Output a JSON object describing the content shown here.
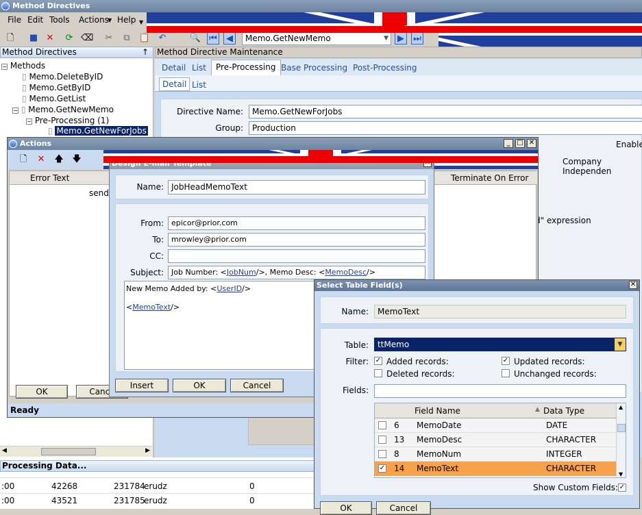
{
  "app": {
    "title": "Method Directives"
  },
  "menu": [
    "File",
    "Edit",
    "Tools",
    "Actions",
    "Help"
  ],
  "toolbar": {
    "nav_value": "Memo.GetNewMemo"
  },
  "tree": {
    "panel_title": "Method Directives",
    "pin": "↑",
    "items": [
      {
        "label": "Methods",
        "icon": "minus-box-icon"
      },
      {
        "label": "Memo.DeleteByID",
        "icon": "document-icon"
      },
      {
        "label": "Memo.GetByID",
        "icon": "document-icon"
      },
      {
        "label": "Memo.GetList",
        "icon": "document-icon"
      },
      {
        "label": "Memo.GetNewMemo",
        "icon": "document-icon"
      },
      {
        "label": "Pre-Processing (1)",
        "icon": "minus-box-icon"
      },
      {
        "label": "Memo.GetNewForJobs",
        "icon": "document-icon"
      }
    ]
  },
  "maintenance": {
    "title": "Method Directive Maintenance",
    "tabs": [
      "Detail",
      "List",
      "Pre-Processing",
      "Base Processing",
      "Post-Processing"
    ],
    "subtabs": [
      "Detail",
      "List"
    ],
    "directive_name_label": "Directive Name:",
    "directive_name": "Memo.GetNewForJobs",
    "group_label": "Group:",
    "group": "Production",
    "enable_label": "Enable",
    "company_label": "Company Independen",
    "expression_text": "d\" expression"
  },
  "actions": {
    "title": "Actions",
    "columns": [
      "Error Text",
      "Terminate On Error"
    ],
    "row_text": "send",
    "ok": "OK",
    "cancel": "Cance",
    "status": "Ready"
  },
  "email": {
    "title": "Design E-mail Template",
    "name_label": "Name:",
    "name": "JobHeadMemoText",
    "from_label": "From:",
    "from": "epicor@prior.com",
    "to_label": "To:",
    "to": "mrowley@prior.com",
    "cc_label": "CC:",
    "cc": "",
    "subject_label": "Subject:",
    "subject_a": "Job Number:  <",
    "subject_link1": "JobNum",
    "subject_b": "/>,    Memo Desc: <",
    "subject_link2": "MemoDesc",
    "subject_c": "/>",
    "body_a": "New Memo Added by:  <",
    "body_link1": "UserID",
    "body_b": "/>",
    "body_c": "<",
    "body_link2": "MemoText",
    "body_d": "/>",
    "insert": "Insert",
    "ok": "OK",
    "cancel": "Cancel"
  },
  "select": {
    "title": "Select Table Field(s)",
    "name_label": "Name:",
    "name": "MemoText",
    "table_label": "Table:",
    "table": "ttMemo",
    "filter_label": "Filter:",
    "filters": [
      {
        "label": "Added records:",
        "checked": true
      },
      {
        "label": "Updated records:",
        "checked": true
      },
      {
        "label": "Deleted records:",
        "checked": false
      },
      {
        "label": "Unchanged records:",
        "checked": false
      }
    ],
    "fields_label": "Fields:",
    "fields_value": "",
    "col_name": "Field Name",
    "col_type": "Data Type",
    "rows": [
      {
        "num": "6",
        "name": "MemoDate",
        "type": "DATE",
        "checked": false
      },
      {
        "num": "13",
        "name": "MemoDesc",
        "type": "CHARACTER",
        "checked": false
      },
      {
        "num": "8",
        "name": "MemoNum",
        "type": "INTEGER",
        "checked": false
      },
      {
        "num": "14",
        "name": "MemoText",
        "type": "CHARACTER",
        "checked": true
      }
    ],
    "show_custom_label": "Show Custom Fields:",
    "show_custom": true,
    "ok": "OK",
    "cancel": "Cancel"
  },
  "processing": {
    "title": "Processing Data...",
    "rows": [
      {
        "a": ":00",
        "b": "42268",
        "c": "231784",
        "d": "erudz",
        "e": "0"
      },
      {
        "a": ":00",
        "b": "43521",
        "c": "231785",
        "d": "erudz",
        "e": "0"
      }
    ]
  }
}
